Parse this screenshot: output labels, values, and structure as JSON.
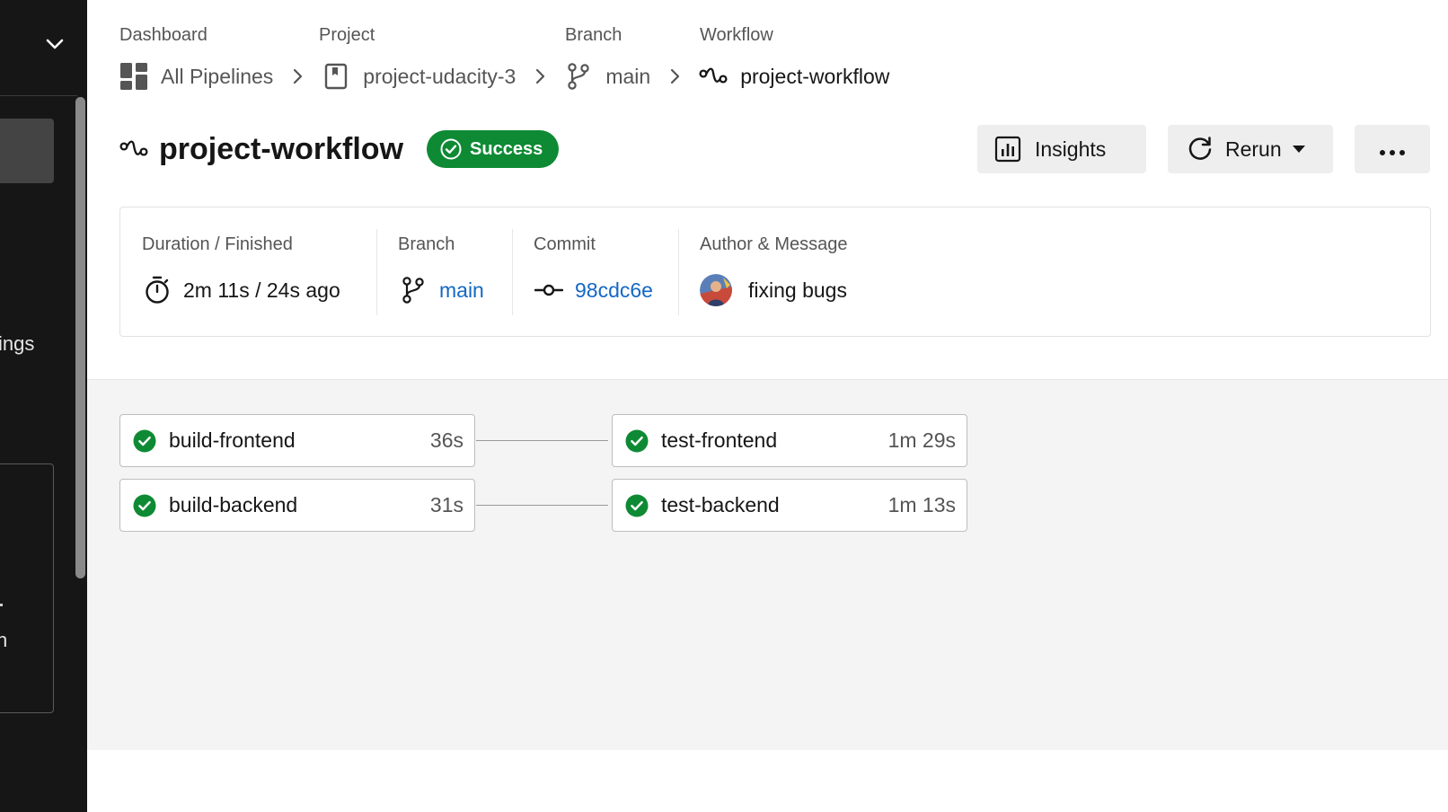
{
  "breadcrumb": {
    "labels": [
      "Dashboard",
      "Project",
      "Branch",
      "Workflow"
    ],
    "dashboard": "All Pipelines",
    "project": "project-udacity-3",
    "branch": "main",
    "workflow": "project-workflow"
  },
  "header": {
    "title": "project-workflow",
    "status": "Success",
    "insights_label": "Insights",
    "rerun_label": "Rerun",
    "more_label": "•••"
  },
  "info": {
    "duration_label": "Duration / Finished",
    "duration_value": "2m 11s / 24s ago",
    "branch_label": "Branch",
    "branch_value": "main",
    "commit_label": "Commit",
    "commit_value": "98cdc6e",
    "author_label": "Author & Message",
    "message": "fixing bugs"
  },
  "jobs": [
    {
      "name": "build-frontend",
      "duration": "36s",
      "status": "success"
    },
    {
      "name": "build-backend",
      "duration": "31s",
      "status": "success"
    },
    {
      "name": "test-frontend",
      "duration": "1m 29s",
      "status": "success"
    },
    {
      "name": "test-backend",
      "duration": "1m 13s",
      "status": "success"
    }
  ],
  "sidebar": {
    "partial_text_1": "ings",
    "partial_text_2": "n"
  },
  "colors": {
    "success": "#0e8a34",
    "link": "#1368c4",
    "sidebar_bg": "#161616"
  }
}
